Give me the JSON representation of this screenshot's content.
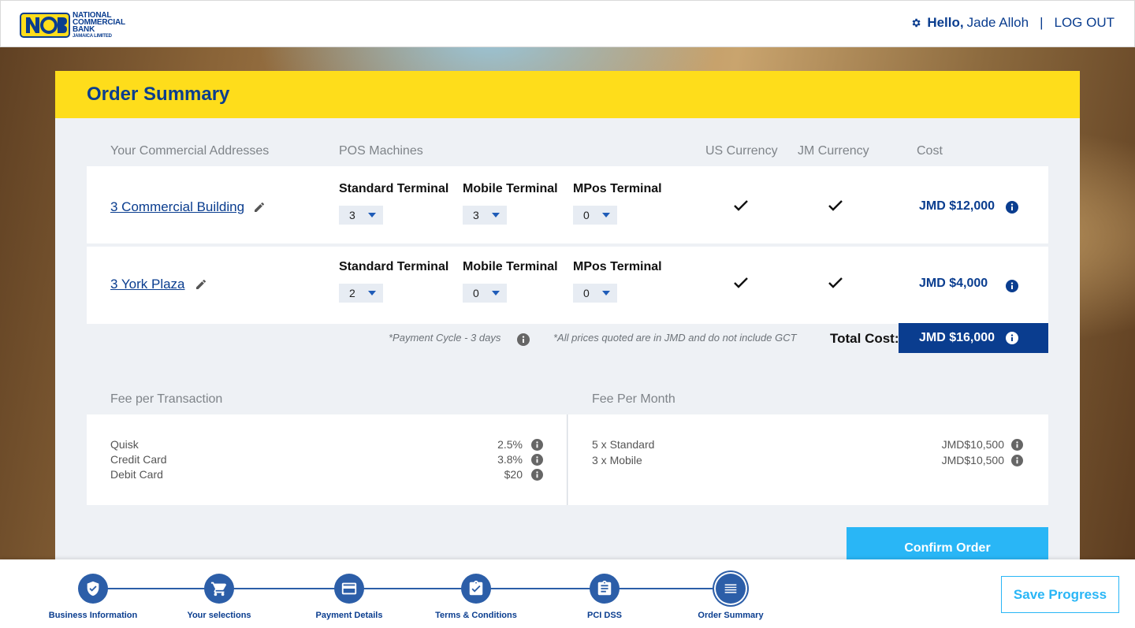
{
  "brand": {
    "logo_lines": [
      "NATIONAL",
      "COMMERCIAL",
      "BANK"
    ],
    "logo_sub": "JAMAICA LIMITED",
    "colors": {
      "primary": "#0a3d8f",
      "yellow": "#fedd1b",
      "accent": "#29b6f6"
    }
  },
  "header": {
    "greeting": "Hello,",
    "user_name": "Jade Alloh",
    "separator": "|",
    "logout_label": "LOG OUT"
  },
  "summary": {
    "title": "Order Summary",
    "columns": {
      "addresses": "Your Commercial Addresses",
      "pos": "POS Machines",
      "us_currency": "US Currency",
      "jm_currency": "JM Currency",
      "cost": "Cost"
    },
    "rows": [
      {
        "address": "3 Commercial Building",
        "terminals": [
          {
            "label": "Standard Terminal",
            "qty": "3"
          },
          {
            "label": "Mobile Terminal",
            "qty": "3"
          },
          {
            "label": "MPos Terminal",
            "qty": "0"
          }
        ],
        "us_currency": true,
        "jm_currency": true,
        "cost": "JMD $12,000"
      },
      {
        "address": "3 York Plaza",
        "terminals": [
          {
            "label": "Standard Terminal",
            "qty": "2"
          },
          {
            "label": "Mobile Terminal",
            "qty": "0"
          },
          {
            "label": "MPos Terminal",
            "qty": "0"
          }
        ],
        "us_currency": true,
        "jm_currency": true,
        "cost": "JMD $4,000"
      }
    ],
    "payment_cycle_note": "*Payment Cycle - 3 days",
    "gct_note": "*All prices quoted are in JMD and do not include GCT",
    "total_label": "Total Cost:",
    "total_value": "JMD $16,000"
  },
  "fees": {
    "transaction": {
      "title": "Fee per Transaction",
      "items": [
        {
          "name": "Quisk",
          "value": "2.5%"
        },
        {
          "name": "Credit Card",
          "value": "3.8%"
        },
        {
          "name": "Debit Card",
          "value": "$20"
        }
      ]
    },
    "monthly": {
      "title": "Fee Per Month",
      "items": [
        {
          "name": "5 x Standard",
          "value": "JMD$10,500"
        },
        {
          "name": "3 x Mobile",
          "value": "JMD$10,500"
        }
      ]
    }
  },
  "actions": {
    "confirm_label": "Confirm Order",
    "save_label": "Save Progress"
  },
  "steps": [
    {
      "label": "Business Information",
      "icon": "shield-check-icon"
    },
    {
      "label": "Your selections",
      "icon": "cart-icon"
    },
    {
      "label": "Payment Details",
      "icon": "credit-card-icon"
    },
    {
      "label": "Terms & Conditions",
      "icon": "clipboard-check-icon"
    },
    {
      "label": "PCI DSS",
      "icon": "clipboard-list-icon"
    },
    {
      "label": "Order Summary",
      "icon": "list-icon",
      "active": true
    }
  ]
}
